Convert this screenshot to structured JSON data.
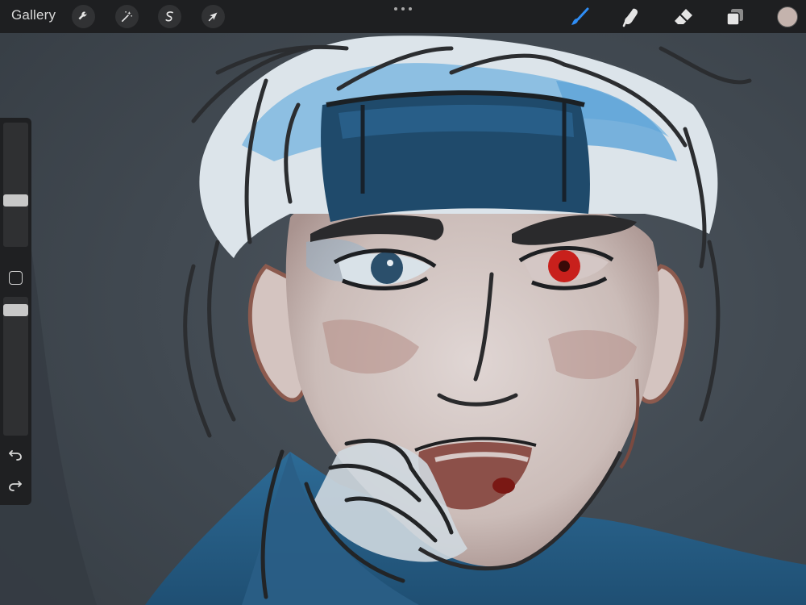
{
  "topbar": {
    "gallery_label": "Gallery",
    "tools_left": [
      {
        "name": "actions",
        "icon": "wrench-icon"
      },
      {
        "name": "adjustments",
        "icon": "magic-wand-icon"
      },
      {
        "name": "selection",
        "icon": "selection-s-icon"
      },
      {
        "name": "transform",
        "icon": "arrow-cursor-icon"
      }
    ],
    "more_icon": "more-dots-icon",
    "tools_right": [
      {
        "name": "brush",
        "icon": "brush-icon",
        "active": true
      },
      {
        "name": "smudge",
        "icon": "smudge-icon"
      },
      {
        "name": "eraser",
        "icon": "eraser-icon"
      },
      {
        "name": "layers",
        "icon": "layers-icon"
      }
    ],
    "current_color": "#c4b3ad",
    "active_color": "#2f8df5"
  },
  "sidebar": {
    "brush_size_level": 0.36,
    "brush_opacity_level": 0.94,
    "modify_icon": "square-icon",
    "undo_icon": "undo-icon",
    "redo_icon": "redo-icon"
  },
  "canvas": {
    "subject": "painting",
    "palette": {
      "background": "#3d454d",
      "skin": "#cfc6c4",
      "blue": "#2a6a96",
      "light_blue": "#8ec3e6",
      "dark_line": "#232527",
      "red_eye": "#c8201c"
    }
  }
}
